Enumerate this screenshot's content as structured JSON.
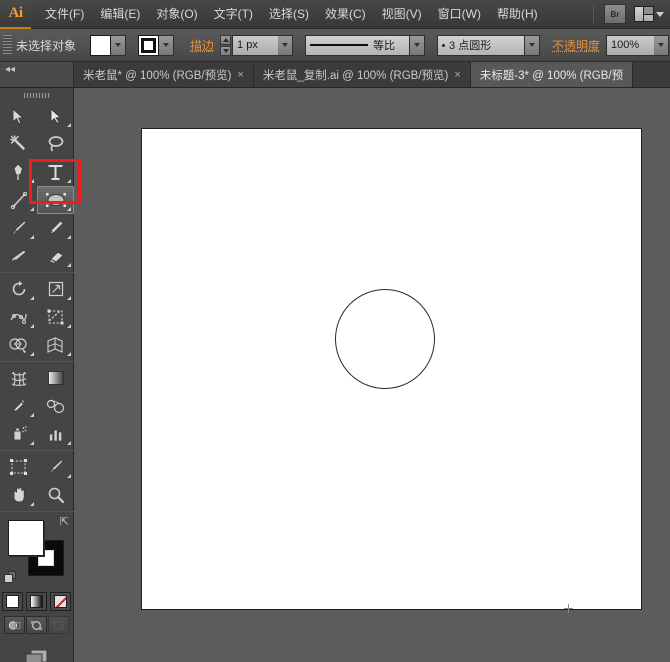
{
  "app": {
    "name": "Adobe Illustrator",
    "logo_text": "Ai"
  },
  "menubar": {
    "items": [
      {
        "label": "文件(F)",
        "name": "menu-file"
      },
      {
        "label": "编辑(E)",
        "name": "menu-edit"
      },
      {
        "label": "对象(O)",
        "name": "menu-object"
      },
      {
        "label": "文字(T)",
        "name": "menu-type"
      },
      {
        "label": "选择(S)",
        "name": "menu-select"
      },
      {
        "label": "效果(C)",
        "name": "menu-effect"
      },
      {
        "label": "视图(V)",
        "name": "menu-view"
      },
      {
        "label": "窗口(W)",
        "name": "menu-window"
      },
      {
        "label": "帮助(H)",
        "name": "menu-help"
      }
    ],
    "bridge_label": "Br",
    "workspace_label": ""
  },
  "controlbar": {
    "selection_status": "未选择对象",
    "fill_label": "填色",
    "stroke_swatch_label": "描边颜色",
    "stroke_label": "描边",
    "stroke_weight": "1 px",
    "stroke_profile": "等比",
    "brush_definition": "3 点圆形",
    "opacity_label": "不透明度",
    "opacity_value": "100%",
    "accent_orange": "#e2913e"
  },
  "tabs": [
    {
      "title": "米老鼠* @ 100% (RGB/预览)",
      "close": "×",
      "active": false
    },
    {
      "title": "米老鼠_复制.ai @ 100% (RGB/预览)",
      "close": "×",
      "active": false
    },
    {
      "title": "未标题-3* @ 100% (RGB/预",
      "close": "",
      "active": true
    }
  ],
  "toolbar": {
    "tools": [
      {
        "name": "selection-tool",
        "label": "选择工具",
        "has_flyout": false
      },
      {
        "name": "direct-selection-tool",
        "label": "直接选择工具",
        "has_flyout": true
      },
      {
        "name": "magic-wand-tool",
        "label": "魔棒工具",
        "has_flyout": false
      },
      {
        "name": "lasso-tool",
        "label": "套索工具",
        "has_flyout": false
      },
      {
        "name": "pen-tool",
        "label": "钢笔工具",
        "has_flyout": true
      },
      {
        "name": "type-tool",
        "label": "文字工具",
        "has_flyout": true
      },
      {
        "name": "line-segment-tool",
        "label": "直线段工具",
        "has_flyout": true
      },
      {
        "name": "ellipse-tool",
        "label": "椭圆工具",
        "has_flyout": true,
        "selected": true
      },
      {
        "name": "paintbrush-tool",
        "label": "画笔工具",
        "has_flyout": true
      },
      {
        "name": "pencil-tool",
        "label": "铅笔工具",
        "has_flyout": true
      },
      {
        "name": "blob-brush-tool",
        "label": "斑点画笔工具",
        "has_flyout": false
      },
      {
        "name": "eraser-tool",
        "label": "橡皮擦工具",
        "has_flyout": true
      },
      {
        "name": "rotate-tool",
        "label": "旋转工具",
        "has_flyout": true
      },
      {
        "name": "scale-tool",
        "label": "比例缩放工具",
        "has_flyout": true
      },
      {
        "name": "width-tool",
        "label": "宽度工具",
        "has_flyout": true
      },
      {
        "name": "free-transform-tool",
        "label": "自由变换工具",
        "has_flyout": false
      },
      {
        "name": "shape-builder-tool",
        "label": "形状生成器工具",
        "has_flyout": true
      },
      {
        "name": "perspective-grid-tool",
        "label": "透视网格工具",
        "has_flyout": true
      },
      {
        "name": "mesh-tool",
        "label": "网格工具",
        "has_flyout": false
      },
      {
        "name": "gradient-tool",
        "label": "渐变工具",
        "has_flyout": false
      },
      {
        "name": "eyedropper-tool",
        "label": "吸管工具",
        "has_flyout": true
      },
      {
        "name": "blend-tool",
        "label": "混合工具",
        "has_flyout": false
      },
      {
        "name": "symbol-sprayer-tool",
        "label": "符号喷枪工具",
        "has_flyout": true
      },
      {
        "name": "column-graph-tool",
        "label": "柱形图工具",
        "has_flyout": true
      },
      {
        "name": "artboard-tool",
        "label": "画板工具",
        "has_flyout": false
      },
      {
        "name": "slice-tool",
        "label": "切片工具",
        "has_flyout": true
      },
      {
        "name": "hand-tool",
        "label": "抓手工具",
        "has_flyout": true
      },
      {
        "name": "zoom-tool",
        "label": "缩放工具",
        "has_flyout": false
      }
    ],
    "fill_color": "#ffffff",
    "stroke_color": "#000000",
    "fill_modes": [
      {
        "name": "color-mode-button",
        "label": "颜色"
      },
      {
        "name": "gradient-mode-button",
        "label": "渐变"
      },
      {
        "name": "none-mode-button",
        "label": "无"
      }
    ],
    "screen_modes": [
      {
        "name": "normal-screen-mode-button",
        "label": "正常屏幕模式"
      },
      {
        "name": "fullscreen-menubar-mode-button",
        "label": "带有菜单栏的全屏模式"
      },
      {
        "name": "fullscreen-mode-button",
        "label": "全屏模式"
      }
    ],
    "panel_toggle_label": "更改屏幕模式"
  },
  "canvas": {
    "artboard_background": "#ffffff",
    "shape": {
      "name": "ellipse-shape",
      "type": "circle",
      "stroke": "#2a2a2a",
      "fill": "none"
    }
  },
  "annotation": {
    "name": "ellipse-tool-highlight",
    "color": "#ee1c1c",
    "shape": "rectangle"
  }
}
